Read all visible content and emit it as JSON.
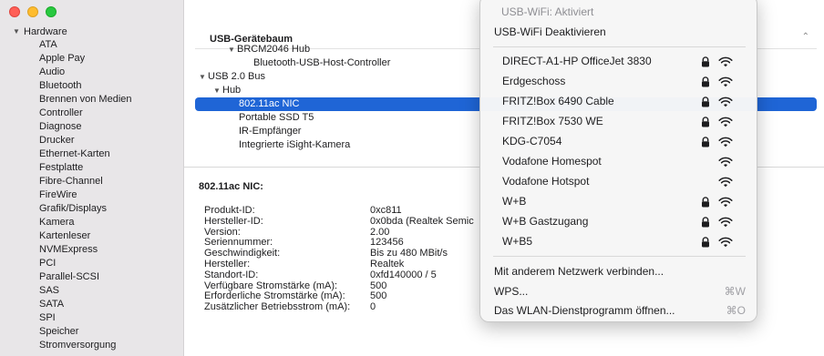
{
  "window": {
    "sidebar": {
      "root_label": "Hardware",
      "items": [
        "ATA",
        "Apple Pay",
        "Audio",
        "Bluetooth",
        "Brennen von Medien",
        "Controller",
        "Diagnose",
        "Drucker",
        "Ethernet-Karten",
        "Festplatte",
        "Fibre-Channel",
        "FireWire",
        "Grafik/Displays",
        "Kamera",
        "Kartenleser",
        "NVMExpress",
        "PCI",
        "Parallel-SCSI",
        "SAS",
        "SATA",
        "SPI",
        "Speicher",
        "Stromversorgung"
      ]
    },
    "tree": {
      "header": "USB-Gerätebaum",
      "rows": [
        {
          "label": "BRCM2046 Hub"
        },
        {
          "label": "Bluetooth-USB-Host-Controller"
        },
        {
          "label": "USB 2.0 Bus"
        },
        {
          "label": "Hub"
        },
        {
          "label": "802.11ac NIC"
        },
        {
          "label": "Portable SSD T5"
        },
        {
          "label": "IR-Empfänger"
        },
        {
          "label": "Integrierte iSight-Kamera"
        }
      ]
    },
    "details": {
      "title": "802.11ac NIC:",
      "properties": [
        {
          "key": "Produkt-ID:",
          "value": "0xc811"
        },
        {
          "key": "Hersteller-ID:",
          "value": "0x0bda  (Realtek Semic"
        },
        {
          "key": "Version:",
          "value": "2.00"
        },
        {
          "key": "Seriennummer:",
          "value": "123456"
        },
        {
          "key": "Geschwindigkeit:",
          "value": "Bis zu 480 MBit/s"
        },
        {
          "key": "Hersteller:",
          "value": "Realtek"
        },
        {
          "key": "Standort-ID:",
          "value": "0xfd140000 / 5"
        },
        {
          "key": "Verfügbare Stromstärke (mA):",
          "value": "500"
        },
        {
          "key": "Erforderliche Stromstärke (mA):",
          "value": "500"
        },
        {
          "key": "Zusätzlicher Betriebsstrom (mA):",
          "value": "0"
        }
      ]
    }
  },
  "wifi_menu": {
    "status": "USB-WiFi: Aktiviert",
    "toggle_label": "USB-WiFi Deaktivieren",
    "networks": [
      {
        "name": "DIRECT-A1-HP OfficeJet 3830",
        "secured": true,
        "icon": "wifi-icon"
      },
      {
        "name": "Erdgeschoss",
        "secured": true,
        "icon": "wifi-icon"
      },
      {
        "name": "FRITZ!Box 6490 Cable",
        "secured": true,
        "icon": "wifi-icon"
      },
      {
        "name": "FRITZ!Box 7530 WE",
        "secured": true,
        "icon": "wifi-icon"
      },
      {
        "name": "KDG-C7054",
        "secured": true,
        "icon": "wifi-icon"
      },
      {
        "name": "Vodafone Homespot",
        "secured": false,
        "icon": "wifi-icon"
      },
      {
        "name": "Vodafone Hotspot",
        "secured": false,
        "icon": "wifi-icon"
      },
      {
        "name": "W+B",
        "secured": true,
        "icon": "wifi-icon"
      },
      {
        "name": "W+B Gastzugang",
        "secured": true,
        "icon": "wifi-icon"
      },
      {
        "name": "W+B5",
        "secured": true,
        "icon": "wifi-icon"
      }
    ],
    "other_network": "Mit anderem Netzwerk verbinden...",
    "wps": "WPS...",
    "wps_shortcut": "⌘W",
    "open_utility": "Das WLAN-Dienstprogramm öffnen...",
    "open_utility_shortcut": "⌘O"
  },
  "colors": {
    "selection": "#1f65d6",
    "close": "#ff5f57",
    "minimize": "#febc2e",
    "zoom": "#28c840"
  }
}
